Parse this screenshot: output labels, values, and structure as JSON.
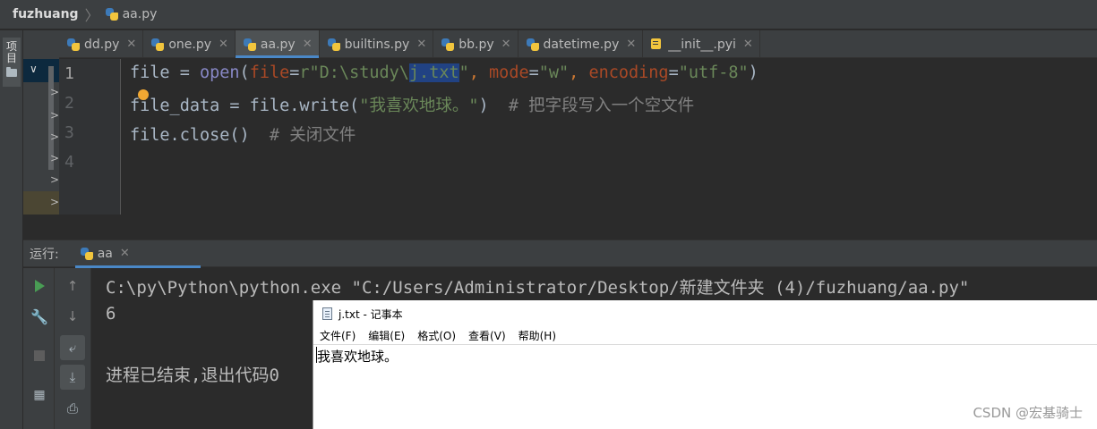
{
  "breadcrumb": {
    "project": "fuzhuang",
    "file": "aa.py"
  },
  "left_strip": {
    "project_tab": "项目"
  },
  "tabs": [
    {
      "label": "dd.py",
      "icon": "python-file-icon",
      "active": false
    },
    {
      "label": "one.py",
      "icon": "python-file-icon",
      "active": false
    },
    {
      "label": "aa.py",
      "icon": "python-file-icon",
      "active": true
    },
    {
      "label": "builtins.py",
      "icon": "python-file-icon",
      "active": false
    },
    {
      "label": "bb.py",
      "icon": "python-file-icon",
      "active": false
    },
    {
      "label": "datetime.py",
      "icon": "python-file-icon",
      "active": false
    },
    {
      "label": "__init__.pyi",
      "icon": "python-stub-icon",
      "active": false
    }
  ],
  "tab_close_glyph": "✕",
  "editor": {
    "line_numbers": [
      "1",
      "2",
      "3",
      "4"
    ],
    "line1": {
      "var": "file",
      "eq": " = ",
      "func": "open",
      "p1": "(",
      "param_file": "file",
      "eq2": "=",
      "str_prefix": "r\"D:\\study\\",
      "str_selected": "j.txt",
      "str_end": "\"",
      "comma1": ", ",
      "param_mode": "mode",
      "eq3": "=",
      "str_mode": "\"w\"",
      "comma2": ", ",
      "param_enc": "encoding",
      "eq4": "=",
      "str_enc": "\"utf-8\"",
      "p2": ")"
    },
    "line2": {
      "code": "file_data = file.write(",
      "str": "\"我喜欢地球。\"",
      "close": ")",
      "comment": "  # 把字段写入一个空文件"
    },
    "line3": {
      "code": "file.close()",
      "comment": "  # 关闭文件"
    }
  },
  "run": {
    "label": "运行:",
    "tab": "aa",
    "console_lines": [
      "C:\\py\\Python\\python.exe \"C:/Users/Administrator/Desktop/新建文件夹 (4)/fuzhuang/aa.py\"",
      "6",
      "进程已结束,退出代码0"
    ]
  },
  "notepad": {
    "title": "j.txt - 记事本",
    "menu": [
      "文件(F)",
      "编辑(E)",
      "格式(O)",
      "查看(V)",
      "帮助(H)"
    ],
    "content": "我喜欢地球。"
  },
  "watermark": "CSDN @宏基骑士",
  "colors": {
    "accent": "#4a88c7",
    "run_green": "#499c54",
    "string": "#6a8759",
    "param": "#aa4926",
    "builtin": "#8888c6",
    "comment": "#808080",
    "selection": "#214283"
  }
}
